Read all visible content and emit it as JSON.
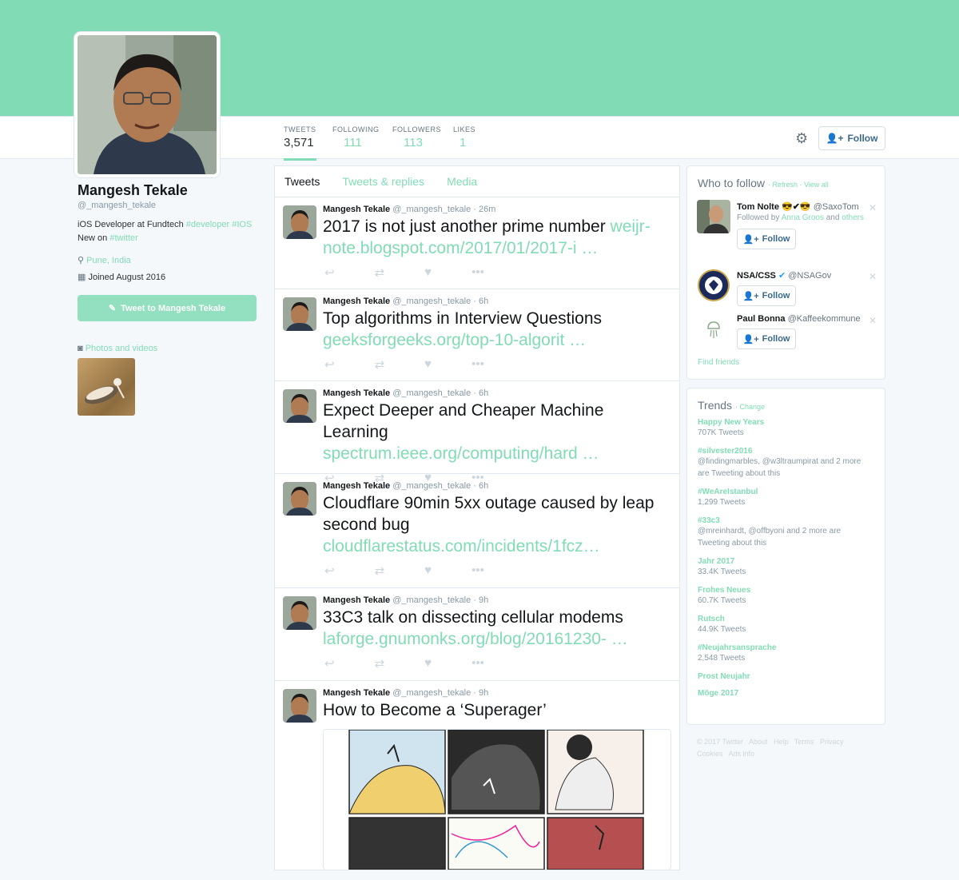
{
  "profile": {
    "name": "Mangesh Tekale",
    "handle": "@_mangesh_tekale",
    "bio_prefix": "iOS Developer at Fundtech ",
    "bio_tags": "#developer #IOS",
    "bio_line2_prefix": "New on ",
    "bio_line2_tag": "#twitter",
    "location": "Pune, India",
    "joined": "Joined August 2016",
    "tweet_to_label": "Tweet to Mangesh Tekale",
    "photos_label": "Photos and videos"
  },
  "stats": [
    {
      "label": "TWEETS",
      "value": "3,571"
    },
    {
      "label": "FOLLOWING",
      "value": "111"
    },
    {
      "label": "FOLLOWERS",
      "value": "113"
    },
    {
      "label": "LIKES",
      "value": "1"
    }
  ],
  "follow_label": "Follow",
  "tabs": [
    "Tweets",
    "Tweets & replies",
    "Media"
  ],
  "tweets": [
    {
      "name": "Mangesh Tekale",
      "meta": "@_mangesh_tekale · 26m",
      "text": "2017 is not just another prime number ",
      "link_inline": "weijr-",
      "link": "note.blogspot.com/2017/01/2017-i …"
    },
    {
      "name": "Mangesh Tekale",
      "meta": "@_mangesh_tekale · 6h",
      "text": "Top algorithms in Interview Questions",
      "link_inline": "",
      "link": "geeksforgeeks.org/top-10-algorit …"
    },
    {
      "name": "Mangesh Tekale",
      "meta": "@_mangesh_tekale · 6h",
      "text": "Expect Deeper and Cheaper Machine Learning",
      "link_inline": "",
      "link": "spectrum.ieee.org/computing/hard …"
    },
    {
      "name": "Mangesh Tekale",
      "meta": "@_mangesh_tekale · 6h",
      "text": "Cloudflare 90min 5xx outage caused by leap second bug",
      "link_inline": "",
      "link": "cloudflarestatus.com/incidents/1fcz…"
    },
    {
      "name": "Mangesh Tekale",
      "meta": "@_mangesh_tekale · 9h",
      "text": "33C3 talk on dissecting cellular modems",
      "link_inline": "",
      "link": "laforge.gnumonks.org/blog/20161230- …"
    },
    {
      "name": "Mangesh Tekale",
      "meta": "@_mangesh_tekale · 9h",
      "text": "How to Become a ‘Superager’",
      "link_inline": "",
      "link": ""
    }
  ],
  "who_to_follow": {
    "title": "Who to follow",
    "refresh": "Refresh",
    "view_all": "View all",
    "find_friends": "Find friends",
    "suggestions": [
      {
        "name": "Tom Nolte 😎✔😎",
        "handle": "@SaxoTom",
        "sub_prefix": "Followed by ",
        "sub_link": "Anna Groos",
        "sub_mid": " and ",
        "sub_link2": "others"
      },
      {
        "name": "NSA/CSS",
        "handle": "@NSAGov",
        "sub_prefix": "",
        "sub_link": "",
        "sub_mid": "",
        "sub_link2": ""
      },
      {
        "name": "Paul Bonna",
        "handle": "@Kaffeekommune",
        "sub_prefix": "",
        "sub_link": "",
        "sub_mid": "",
        "sub_link2": ""
      }
    ]
  },
  "trends": {
    "title": "Trends",
    "change": "Change",
    "items": [
      {
        "name": "Happy New Years",
        "sub": "707K Tweets"
      },
      {
        "name": "#silvester2016",
        "sub": "@findingmarbles, @w3ltraumpirat and 2 more are Tweeting about this"
      },
      {
        "name": "#WeAreIstanbul",
        "sub": "1,299 Tweets"
      },
      {
        "name": "#33c3",
        "sub": "@mreinhardt, @offbyoni and 2 more are Tweeting about this"
      },
      {
        "name": "Jahr 2017",
        "sub": "33.4K Tweets"
      },
      {
        "name": "Frohes Neues",
        "sub": "60.7K Tweets"
      },
      {
        "name": "Rutsch",
        "sub": "44.9K Tweets"
      },
      {
        "name": "#Neujahrsansprache",
        "sub": "2,548 Tweets"
      },
      {
        "name": "Prost Neujahr",
        "sub": ""
      },
      {
        "name": "Möge 2017",
        "sub": ""
      }
    ]
  },
  "footer": [
    "© 2017 Twitter",
    "About",
    "Help",
    "Terms",
    "Privacy",
    "Cookies",
    "Ads info"
  ],
  "colors": {
    "accent": "#81dcb5",
    "text": "#14171a",
    "muted": "#8899a6"
  }
}
